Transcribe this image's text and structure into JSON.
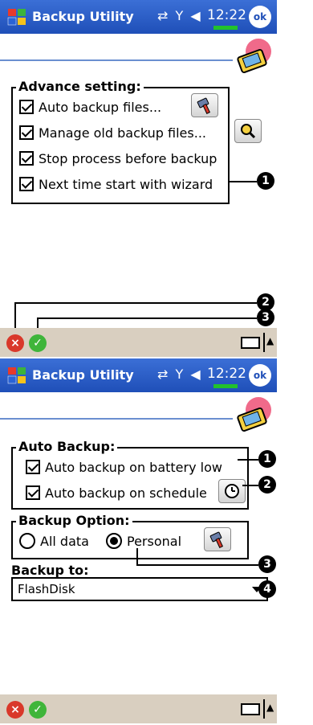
{
  "screen1": {
    "title": "Backup Utility",
    "status_icons": "⇄ Y ◀",
    "clock": "12:22",
    "ok_label": "ok",
    "advance": {
      "title": "Advance setting:",
      "items": [
        {
          "label": "Auto backup files...",
          "checked": true
        },
        {
          "label": "Manage old backup files...",
          "checked": true
        },
        {
          "label": "Stop process before backup",
          "checked": true
        },
        {
          "label": "Next time start with wizard",
          "checked": true
        }
      ]
    },
    "callouts": [
      "1",
      "2",
      "3"
    ],
    "bottom": {
      "cancel": "×",
      "accept": "✓",
      "arrow": "▲"
    }
  },
  "screen2": {
    "title": "Backup Utility",
    "status_icons": "⇄ Y ◀",
    "clock": "12:22",
    "ok_label": "ok",
    "auto_backup": {
      "title": "Auto Backup:",
      "items": [
        {
          "label": "Auto backup on battery low",
          "checked": true
        },
        {
          "label": "Auto backup on schedule",
          "checked": true
        }
      ]
    },
    "backup_option": {
      "title": "Backup Option:",
      "options": [
        {
          "label": "All data",
          "selected": false
        },
        {
          "label": "Personal",
          "selected": true
        }
      ]
    },
    "backup_to_label": "Backup to:",
    "backup_to_value": "FlashDisk",
    "callouts": [
      "1",
      "2",
      "3",
      "4"
    ],
    "bottom": {
      "cancel": "×",
      "accept": "✓",
      "arrow": "▲"
    }
  },
  "colors": {
    "titlebar": "#1f4fb8",
    "bottombar": "#d9cfc0",
    "cancel": "#d9382a",
    "accept": "#3fb53a"
  }
}
